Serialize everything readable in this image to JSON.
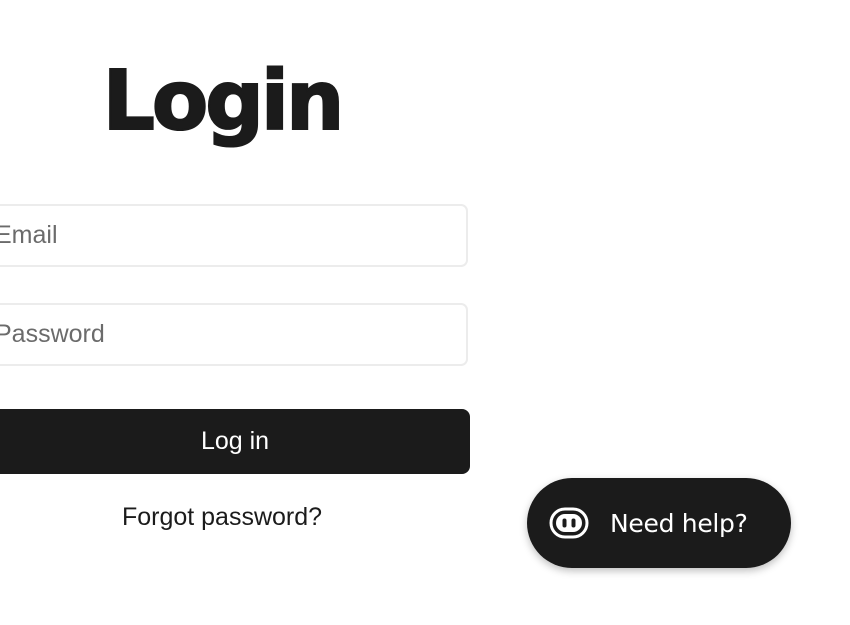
{
  "login": {
    "title": "Login",
    "email": {
      "placeholder": "Email",
      "value": ""
    },
    "password": {
      "placeholder": "Password",
      "value": ""
    },
    "submit_label": "Log in",
    "forgot_label": "Forgot password?"
  },
  "help_widget": {
    "label": "Need help?",
    "icon": "robot-face-icon"
  },
  "colors": {
    "background": "#ffffff",
    "primary": "#1b1b1b",
    "input_border": "#ececec",
    "placeholder": "#6b6b6b",
    "button_text": "#ffffff"
  }
}
